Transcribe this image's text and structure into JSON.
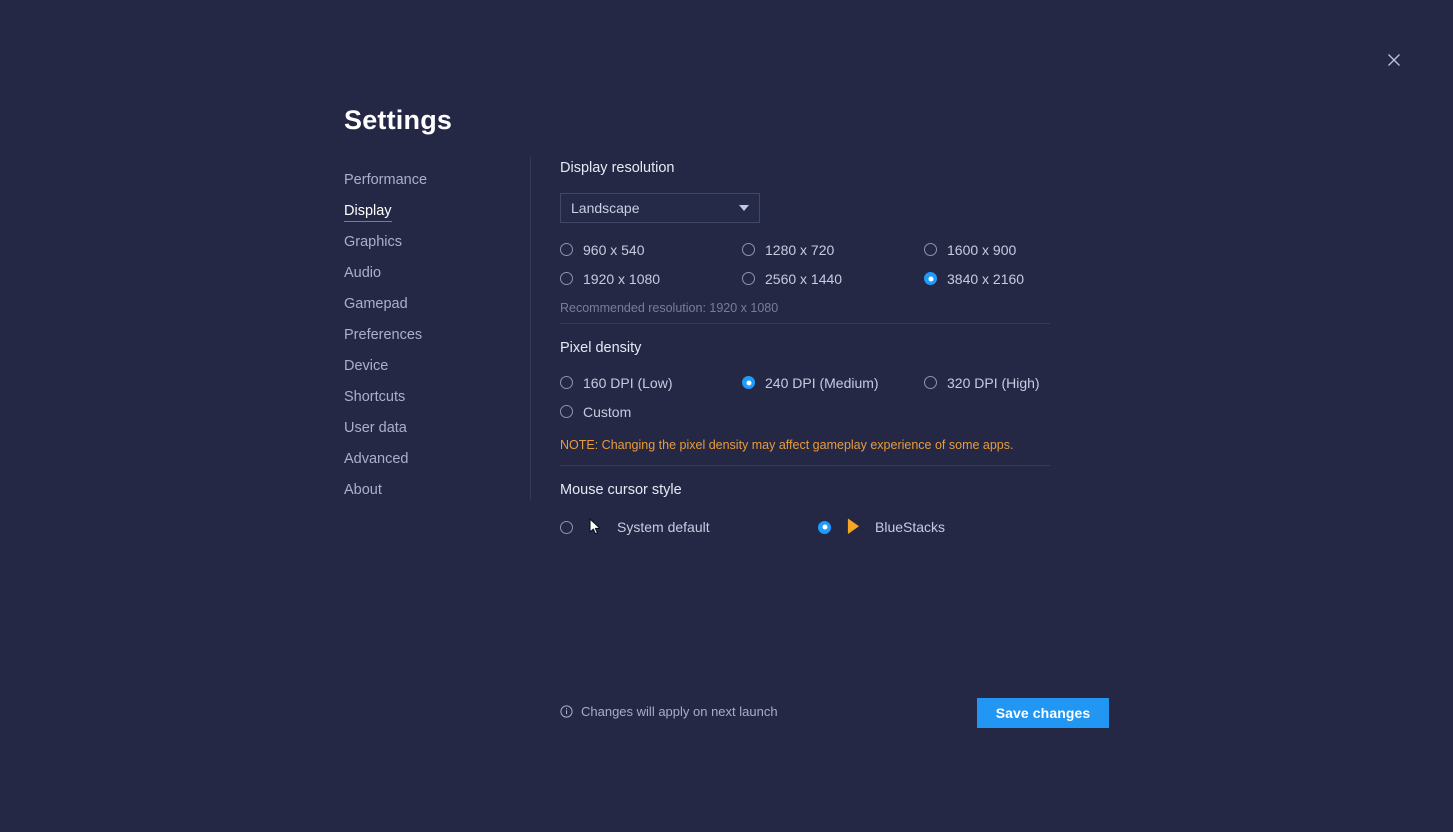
{
  "window": {
    "title": "Settings",
    "close_icon": "close-icon"
  },
  "sidebar": {
    "items": [
      {
        "label": "Performance",
        "active": false
      },
      {
        "label": "Display",
        "active": true
      },
      {
        "label": "Graphics",
        "active": false
      },
      {
        "label": "Audio",
        "active": false
      },
      {
        "label": "Gamepad",
        "active": false
      },
      {
        "label": "Preferences",
        "active": false
      },
      {
        "label": "Device",
        "active": false
      },
      {
        "label": "Shortcuts",
        "active": false
      },
      {
        "label": "User data",
        "active": false
      },
      {
        "label": "Advanced",
        "active": false
      },
      {
        "label": "About",
        "active": false
      }
    ]
  },
  "display_resolution": {
    "title": "Display resolution",
    "orientation_dropdown": {
      "value": "Landscape",
      "icon": "chevron-down-icon"
    },
    "options": [
      {
        "label": "960 x 540",
        "selected": false
      },
      {
        "label": "1280 x 720",
        "selected": false
      },
      {
        "label": "1600 x 900",
        "selected": false
      },
      {
        "label": "1920 x 1080",
        "selected": false
      },
      {
        "label": "2560 x 1440",
        "selected": false
      },
      {
        "label": "3840 x 2160",
        "selected": true
      }
    ],
    "recommended": "Recommended resolution: 1920 x 1080"
  },
  "pixel_density": {
    "title": "Pixel density",
    "options": [
      {
        "label": "160 DPI (Low)",
        "selected": false
      },
      {
        "label": "240 DPI (Medium)",
        "selected": true
      },
      {
        "label": "320 DPI (High)",
        "selected": false
      },
      {
        "label": "Custom",
        "selected": false
      }
    ],
    "note": "NOTE: Changing the pixel density may affect gameplay experience of some apps."
  },
  "mouse_cursor_style": {
    "title": "Mouse cursor style",
    "options": [
      {
        "label": "System default",
        "selected": false,
        "icon": "system-cursor-icon"
      },
      {
        "label": "BlueStacks",
        "selected": true,
        "icon": "bluestacks-cursor-icon"
      }
    ]
  },
  "footer": {
    "info_icon": "info-icon",
    "message": "Changes will apply on next launch",
    "save_label": "Save changes"
  },
  "colors": {
    "background": "#242845",
    "accent": "#2196f3",
    "note": "#e89b3c",
    "text_primary": "#ffffff",
    "text_secondary": "#c6ccdf",
    "text_muted": "#767d9c"
  }
}
